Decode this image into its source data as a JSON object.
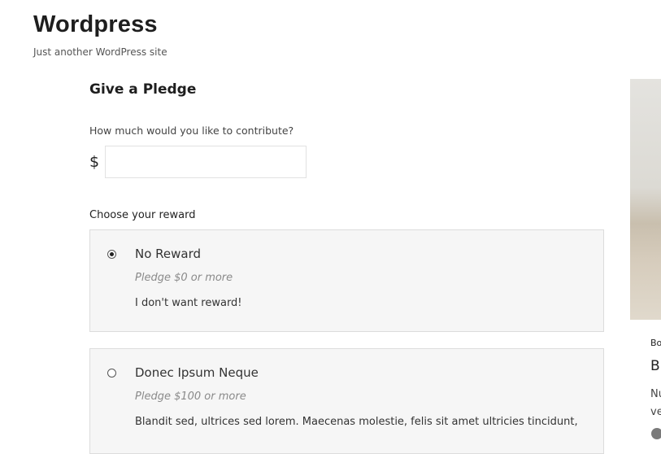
{
  "site": {
    "title": "Wordpress",
    "tagline": "Just another WordPress site"
  },
  "pledge": {
    "title": "Give a Pledge",
    "amount_label": "How much would you like to contribute?",
    "currency": "$",
    "amount_value": "",
    "reward_label": "Choose your reward",
    "rewards": [
      {
        "name": "No Reward",
        "minimum": "Pledge $0 or more",
        "description": "I don't want reward!",
        "selected": true
      },
      {
        "name": "Donec Ipsum Neque",
        "minimum": "Pledge $100 or more",
        "description": "Blandit sed, ultrices sed lorem. Maecenas molestie, felis sit amet ultricies tincidunt,",
        "selected": false
      }
    ]
  },
  "side_post": {
    "category": "Bo",
    "heading": "Br",
    "excerpt_lines": [
      "Nu",
      "ve"
    ]
  }
}
